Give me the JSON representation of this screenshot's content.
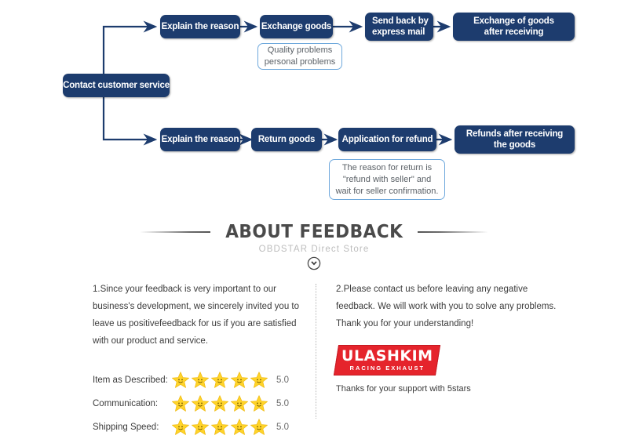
{
  "flow": {
    "root": {
      "label": "Contact customer service"
    },
    "top_row": [
      {
        "label": "Explain the reason"
      },
      {
        "label": "Exchange goods"
      },
      {
        "label": "Send back by\nexpress mail",
        "lines": [
          "Send back by",
          "express mail"
        ]
      },
      {
        "label": "Exchange of goods\nafter receiving",
        "lines": [
          "Exchange of goods",
          "after receiving"
        ]
      }
    ],
    "bottom_row": [
      {
        "label": "Explain the reason"
      },
      {
        "label": "Return goods"
      },
      {
        "label": "Application for refund"
      },
      {
        "label": "Refunds after receiving\nthe goods",
        "lines": [
          "Refunds after receiving",
          "the goods"
        ]
      }
    ],
    "callouts": [
      {
        "lines": [
          "Quality problems",
          "personal problems"
        ]
      },
      {
        "lines": [
          "The reason for return is",
          "\"refund with seller\" and",
          "wait for seller confirmation."
        ]
      }
    ],
    "colors": {
      "node_bg": "#1d3c6e",
      "node_text": "#ffffff",
      "callout_border": "#6ea8dc",
      "callout_text": "#5a6066",
      "connector": "#1d3c6e"
    }
  },
  "feedback_header": {
    "title": "ABOUT FEEDBACK",
    "subtitle": "OBDSTAR Direct Store",
    "chevron_icon": "chevron-down-circle-icon"
  },
  "feedback": {
    "left_paragraph": "1.Since your feedback is very important to our business's development, we sincerely invited you to leave us positivefeedback for us if you are satisfied with our product and service.",
    "right_paragraph": "2.Please contact us before leaving any negative feedback. We will work with you to solve any problems. Thank you for your understanding!",
    "ratings": [
      {
        "label": "Item as Described:",
        "stars": 5,
        "score": "5.0"
      },
      {
        "label": "Communication:",
        "stars": 5,
        "score": "5.0"
      },
      {
        "label": "Shipping Speed:",
        "stars": 5,
        "score": "5.0"
      }
    ],
    "star_icon": "smiley-star-icon",
    "star_color": "#FFD42A",
    "logo": {
      "name": "ULASHKIM",
      "tagline": "RACING EXHAUST",
      "bg_color": "#e5242c"
    },
    "thanks_text": "Thanks for your support with 5stars"
  }
}
